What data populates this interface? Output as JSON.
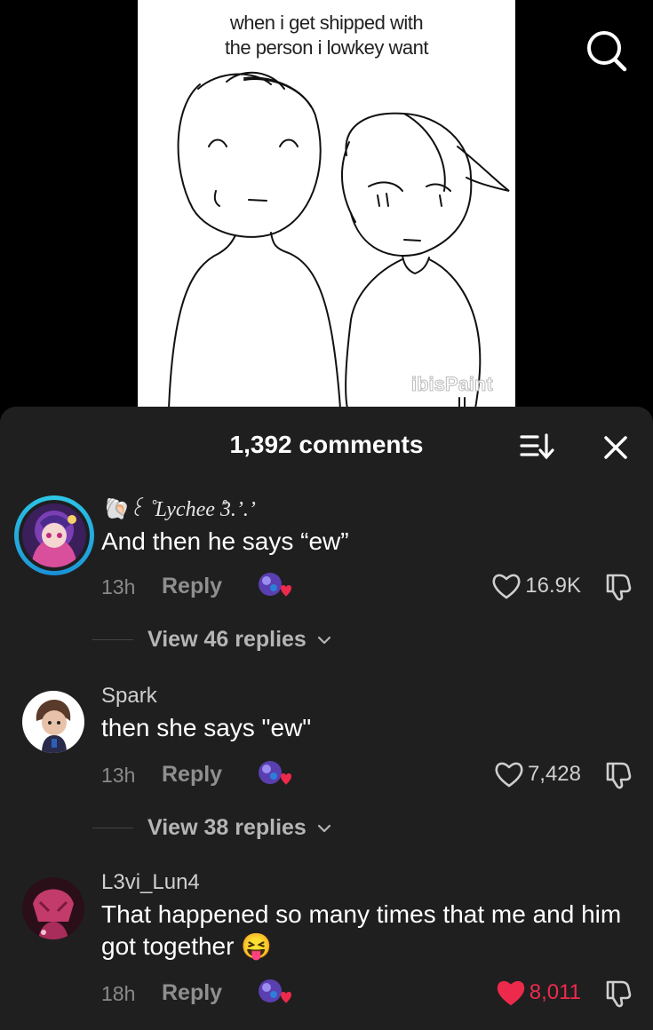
{
  "video": {
    "caption": "when i get shipped with\nthe person i lowkey want",
    "watermark": "ibisPaint",
    "search_icon": "search-icon"
  },
  "comments_sheet": {
    "count_label": "1,392 comments",
    "sort_icon": "sort-icon",
    "close_icon": "close-icon"
  },
  "comments": [
    {
      "username": "🐚꒰ ̊ Lychee ̊3.’.’",
      "text": "And then he says “ew”",
      "time": "13h",
      "reply_label": "Reply",
      "likes": "16.9K",
      "liked": false,
      "view_replies": "View 46 replies"
    },
    {
      "username": "Spark",
      "text": "then she says \"ew\"",
      "time": "13h",
      "reply_label": "Reply",
      "likes": "7,428",
      "liked": false,
      "view_replies": "View 38 replies"
    },
    {
      "username": "L3vi_Lun4",
      "text": "That happened so many times that me and him got together 😝",
      "time": "18h",
      "reply_label": "Reply",
      "likes": "8,011",
      "liked": true
    }
  ],
  "colors": {
    "sheet_bg": "#1f1f1f",
    "liked_red": "#ee2a4c",
    "avatar_ring": "#2ec9e6"
  }
}
